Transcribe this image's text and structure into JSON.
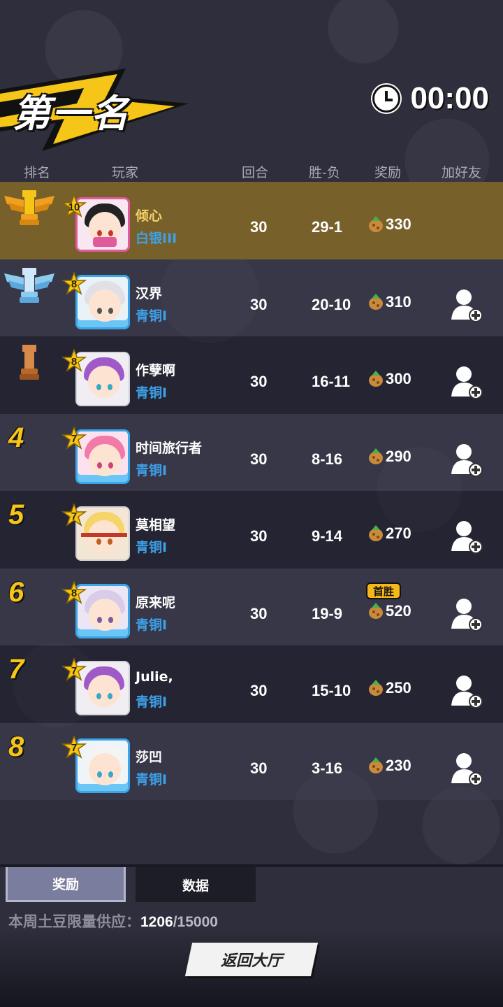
{
  "header": {
    "placement_title": "第一名",
    "timer": "00:00"
  },
  "columns": [
    "排名",
    "玩家",
    "回合",
    "胜-负",
    "奖励",
    "加好友"
  ],
  "rows": [
    {
      "rank": "1",
      "rank_icon": "gold-rook-icon",
      "level": "10",
      "name": "倾心",
      "tier": "白银III",
      "rounds": "30",
      "win_loss": "29-1",
      "reward": "330",
      "first_win": "",
      "self": true
    },
    {
      "rank": "2",
      "rank_icon": "silver-rook-icon",
      "level": "8",
      "name": "汉界",
      "tier": "青铜I",
      "rounds": "30",
      "win_loss": "20-10",
      "reward": "310",
      "first_win": "",
      "self": false
    },
    {
      "rank": "3",
      "rank_icon": "bronze-rook-icon",
      "level": "8",
      "name": "作孽啊",
      "tier": "青铜I",
      "rounds": "30",
      "win_loss": "16-11",
      "reward": "300",
      "first_win": "",
      "self": false
    },
    {
      "rank": "4",
      "level": "7",
      "name": "时间旅行者",
      "tier": "青铜I",
      "rounds": "30",
      "win_loss": "8-16",
      "reward": "290",
      "first_win": "",
      "self": false
    },
    {
      "rank": "5",
      "level": "7",
      "name": "莫相望",
      "tier": "青铜I",
      "rounds": "30",
      "win_loss": "9-14",
      "reward": "270",
      "first_win": "",
      "self": false
    },
    {
      "rank": "6",
      "level": "8",
      "name": "原来呢",
      "tier": "青铜I",
      "rounds": "30",
      "win_loss": "19-9",
      "reward": "520",
      "first_win": "首胜",
      "self": false
    },
    {
      "rank": "7",
      "level": "7",
      "name": "Julie,",
      "tier": "青铜I",
      "rounds": "30",
      "win_loss": "15-10",
      "reward": "250",
      "first_win": "",
      "self": false
    },
    {
      "rank": "8",
      "level": "7",
      "name": "莎凹",
      "tier": "青铜I",
      "rounds": "30",
      "win_loss": "3-16",
      "reward": "230",
      "first_win": "",
      "self": false
    }
  ],
  "tabs": {
    "rewards": "奖励",
    "data": "数据"
  },
  "supply": {
    "label": "本周土豆限量供应：",
    "current": "1206",
    "max": "/15000"
  },
  "back_button": "返回大厅",
  "colors": {
    "self_row": "#77602a",
    "gold": "#f5c518",
    "tier_blue": "#3ea0e8"
  }
}
